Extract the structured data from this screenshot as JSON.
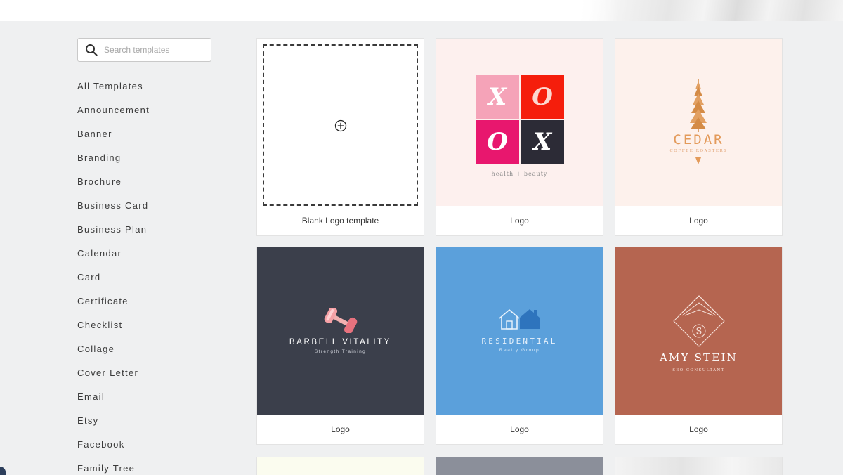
{
  "search": {
    "placeholder": "Search templates"
  },
  "categories": [
    "All Templates",
    "Announcement",
    "Banner",
    "Branding",
    "Brochure",
    "Business Card",
    "Business Plan",
    "Calendar",
    "Card",
    "Certificate",
    "Checklist",
    "Collage",
    "Cover Letter",
    "Email",
    "Etsy",
    "Facebook",
    "Family Tree"
  ],
  "cards": [
    {
      "label": "Blank Logo template"
    },
    {
      "label": "Logo",
      "xo": [
        "X",
        "O",
        "O",
        "X"
      ],
      "tagline": "health + beauty"
    },
    {
      "label": "Logo",
      "name": "CEDAR",
      "sub": "COFFEE ROASTERS"
    },
    {
      "label": "Logo",
      "name": "BARBELL VITALITY",
      "sub": "Strength Training"
    },
    {
      "label": "Logo",
      "name": "RESIDENTIAL",
      "sub": "Realty Group"
    },
    {
      "label": "Logo",
      "name": "AMY STEIN",
      "sub": "SEO CONSULTANT",
      "monogram": "S"
    }
  ],
  "colors": {
    "background": "#eff0f1",
    "xoxo_pink": "#f5a3b8",
    "xoxo_red": "#f51e0c",
    "xoxo_magenta": "#e8176e",
    "xoxo_dark": "#2c2b36",
    "cedar_orange": "#e39a5a",
    "barbell_bg": "#3b3f4b",
    "residential_bg": "#5ba0db",
    "amy_bg": "#b56550"
  }
}
